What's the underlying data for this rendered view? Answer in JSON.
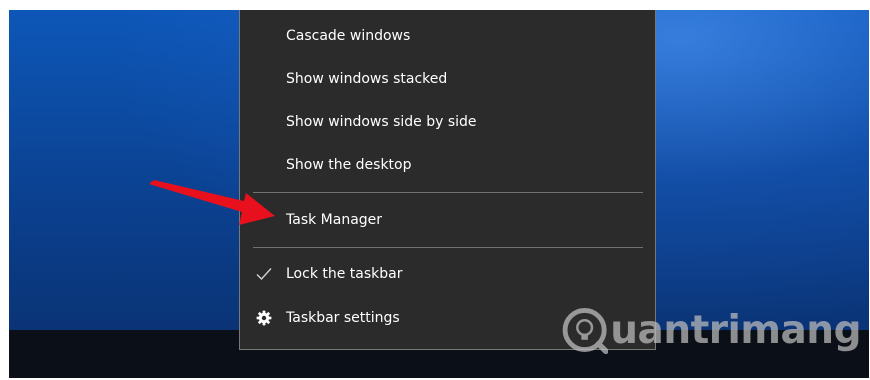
{
  "context_menu": {
    "items": [
      {
        "label": "Cascade windows"
      },
      {
        "label": "Show windows stacked"
      },
      {
        "label": "Show windows side by side"
      },
      {
        "label": "Show the desktop"
      },
      {
        "label": "Task Manager"
      },
      {
        "label": "Lock the taskbar",
        "checked": true,
        "icon": "check-icon"
      },
      {
        "label": "Taskbar settings",
        "icon": "gear-icon"
      }
    ]
  },
  "annotation": {
    "arrow_color": "#e8101c",
    "points_to": "Task Manager"
  },
  "watermark": {
    "text": "uantrimang"
  },
  "colors": {
    "menu_bg": "#2b2b2b",
    "menu_text": "#ffffff",
    "desktop_blue": "#0b4aa0",
    "taskbar": "#0b1018"
  }
}
